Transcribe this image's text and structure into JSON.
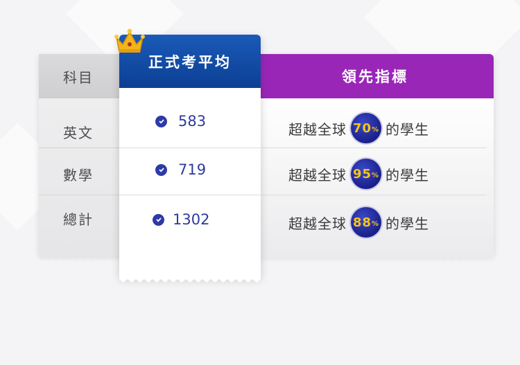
{
  "subjects_header": "科目",
  "average_header": "正式考平均",
  "lead_header": "領先指標",
  "rows": [
    {
      "subject": "英文",
      "score": "583",
      "lead_prefix": "超越全球",
      "percent": "70",
      "percent_sign": "%",
      "lead_suffix": "的學生"
    },
    {
      "subject": "數學",
      "score": "719",
      "lead_prefix": "超越全球",
      "percent": "95",
      "percent_sign": "%",
      "lead_suffix": "的學生"
    },
    {
      "subject": "總計",
      "score": "1302",
      "lead_prefix": "超越全球",
      "percent": "88",
      "percent_sign": "%",
      "lead_suffix": "的學生"
    }
  ],
  "colors": {
    "average_header": "#0c3f94",
    "lead_header": "#9a26b8",
    "badge": "#1a1f88",
    "badge_text": "#f5c518"
  },
  "icons": {
    "crown": "crown-icon",
    "check": "check-circle-icon"
  }
}
